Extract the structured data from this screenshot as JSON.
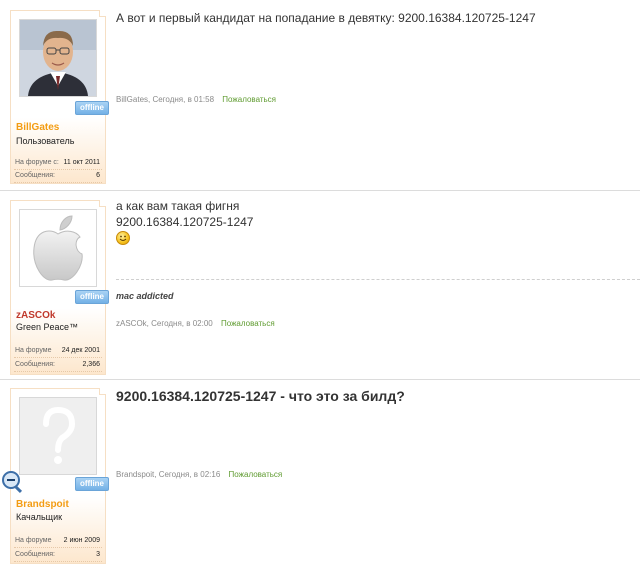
{
  "posts": [
    {
      "username": "BillGates",
      "username_color": "#f39c12",
      "user_title": "Пользователь",
      "status_badge": "offline",
      "avatar": "bill-gates-photo",
      "stats": [
        {
          "label": "На форуме с:",
          "value": "11 окт 2011"
        },
        {
          "label": "Сообщения:",
          "value": "6"
        }
      ],
      "message": "А вот и первый кандидат на попадание в девятку: 9200.16384.120725-1247",
      "meta_text": "BillGates, Сегодня, в 01:58",
      "report_link": "Пожаловаться"
    },
    {
      "username": "zASCOk",
      "username_color": "#c0392b",
      "user_title": "Green Peace™",
      "status_badge": "offline",
      "avatar": "apple-logo",
      "stats": [
        {
          "label": "На форуме",
          "value": "24 дек 2001"
        },
        {
          "label": "Сообщения:",
          "value": "2,366"
        }
      ],
      "message_line1": "а как вам такая фигня",
      "message_line2": "9200.16384.120725-1247",
      "smiley": "smile-icon",
      "signature": "mac addicted",
      "meta_text": "zASCOk, Сегодня, в 02:00",
      "report_link": "Пожаловаться"
    },
    {
      "username": "Brandspoit",
      "username_color": "#f39c12",
      "user_title": "Качальщик",
      "status_badge": "offline",
      "avatar": "question-mark-placeholder",
      "stats": [
        {
          "label": "На форуме",
          "value": "2 июн 2009"
        },
        {
          "label": "Сообщения:",
          "value": "3"
        }
      ],
      "message": "9200.16384.120725-1247 - что это за билд?",
      "meta_text": "Brandspoit, Сегодня, в 02:16",
      "report_link": "Пожаловаться"
    }
  ]
}
